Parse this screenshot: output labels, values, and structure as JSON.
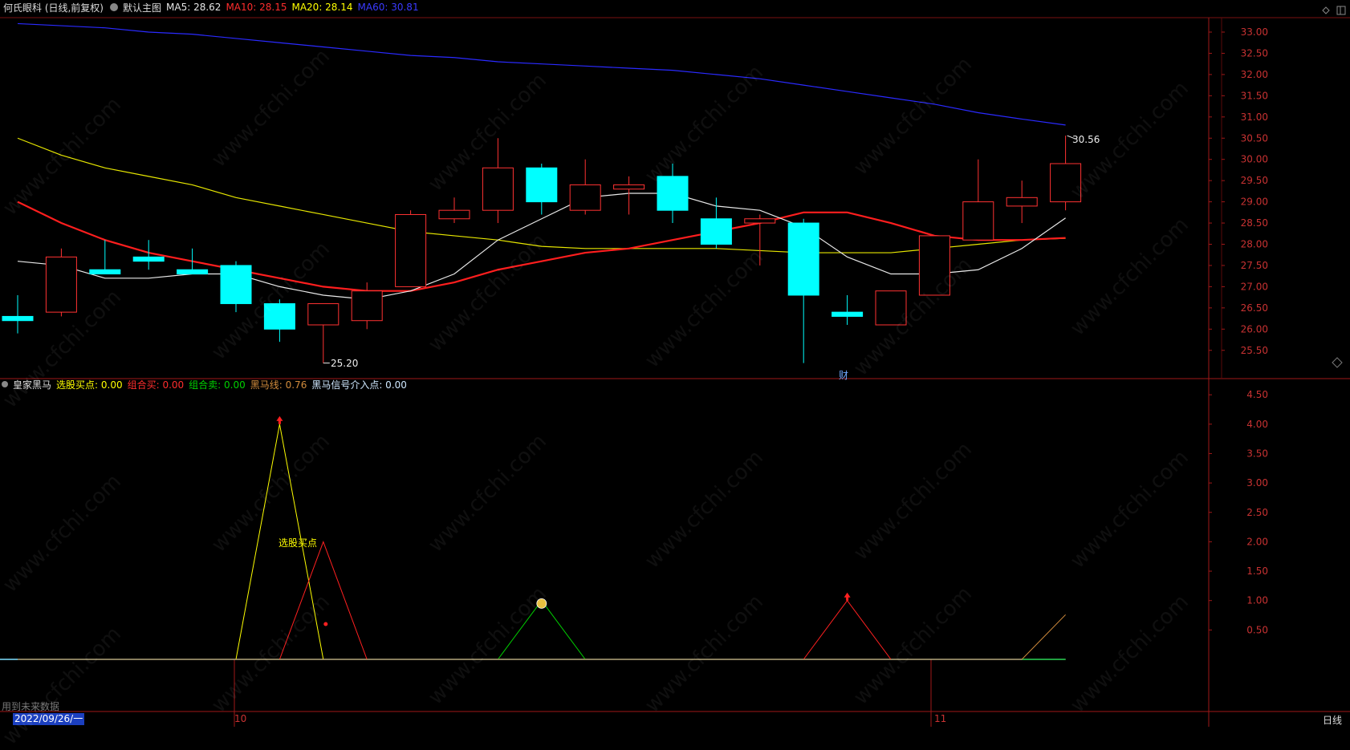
{
  "header": {
    "stock_name": "何氏眼科 (日线,前复权)",
    "template": "默认主图",
    "ma": [
      {
        "label": "MA5: 28.62",
        "color": "#e6e6e6"
      },
      {
        "label": "MA10: 28.15",
        "color": "#ff2d2d"
      },
      {
        "label": "MA20: 28.14",
        "color": "#ffff00"
      },
      {
        "label": "MA60: 30.81",
        "color": "#3a3aff"
      }
    ]
  },
  "indicator_header": {
    "name": "皇家黑马",
    "items": [
      {
        "label": "选股买点: 0.00",
        "color": "#ffff00"
      },
      {
        "label": "组合买: 0.00",
        "color": "#ff2d2d"
      },
      {
        "label": "组合卖: 0.00",
        "color": "#00d000"
      },
      {
        "label": "黑马线: 0.76",
        "color": "#d28c3c"
      },
      {
        "label": "黑马信号介入点: 0.00",
        "color": "#cfe8ff"
      }
    ]
  },
  "annotations": {
    "high_label": "30.56",
    "low_label": "25.20",
    "cai_label": "财",
    "signal_label": "选股买点",
    "future_data": "用到未来数据"
  },
  "footer": {
    "date": "2022/09/26/一",
    "period": "日线",
    "month_labels": [
      "10",
      "11"
    ]
  },
  "watermark": "www.cfchi.com",
  "chart_data": {
    "type": "candlestick",
    "price_ticks": [
      "33.00",
      "32.50",
      "32.00",
      "31.50",
      "31.00",
      "30.50",
      "30.00",
      "29.50",
      "29.00",
      "28.50",
      "28.00",
      "27.50",
      "27.00",
      "26.50",
      "26.00",
      "25.50"
    ],
    "indicator_ticks": [
      "4.50",
      "4.00",
      "3.50",
      "3.00",
      "2.50",
      "2.00",
      "1.50",
      "1.00",
      "0.50"
    ],
    "candles": [
      {
        "o": 26.3,
        "h": 26.8,
        "l": 25.9,
        "c": 26.2
      },
      {
        "o": 26.4,
        "h": 27.9,
        "l": 26.3,
        "c": 27.7
      },
      {
        "o": 27.4,
        "h": 28.1,
        "l": 27.3,
        "c": 27.3
      },
      {
        "o": 27.7,
        "h": 28.1,
        "l": 27.4,
        "c": 27.6
      },
      {
        "o": 27.4,
        "h": 27.9,
        "l": 27.3,
        "c": 27.3
      },
      {
        "o": 27.5,
        "h": 27.6,
        "l": 26.4,
        "c": 26.6
      },
      {
        "o": 26.6,
        "h": 26.7,
        "l": 25.7,
        "c": 26.0
      },
      {
        "o": 26.1,
        "h": 26.6,
        "l": 25.2,
        "c": 26.6
      },
      {
        "o": 26.2,
        "h": 27.1,
        "l": 26.0,
        "c": 26.9
      },
      {
        "o": 27.0,
        "h": 28.8,
        "l": 27.0,
        "c": 28.7
      },
      {
        "o": 28.6,
        "h": 29.1,
        "l": 28.5,
        "c": 28.8
      },
      {
        "o": 28.8,
        "h": 30.5,
        "l": 28.5,
        "c": 29.8
      },
      {
        "o": 29.8,
        "h": 29.9,
        "l": 28.7,
        "c": 29.0
      },
      {
        "o": 28.8,
        "h": 30.0,
        "l": 28.7,
        "c": 29.4
      },
      {
        "o": 29.3,
        "h": 29.6,
        "l": 28.7,
        "c": 29.4
      },
      {
        "o": 29.6,
        "h": 29.9,
        "l": 28.5,
        "c": 28.8
      },
      {
        "o": 28.6,
        "h": 29.1,
        "l": 27.9,
        "c": 28.0
      },
      {
        "o": 28.5,
        "h": 28.7,
        "l": 27.5,
        "c": 28.6
      },
      {
        "o": 28.5,
        "h": 28.6,
        "l": 25.2,
        "c": 26.8
      },
      {
        "o": 26.4,
        "h": 26.8,
        "l": 26.1,
        "c": 26.3
      },
      {
        "o": 26.1,
        "h": 26.9,
        "l": 26.1,
        "c": 26.9
      },
      {
        "o": 26.8,
        "h": 28.2,
        "l": 26.8,
        "c": 28.2
      },
      {
        "o": 28.1,
        "h": 30.0,
        "l": 28.1,
        "c": 29.0
      },
      {
        "o": 28.9,
        "h": 29.5,
        "l": 28.5,
        "c": 29.1
      },
      {
        "o": 29.0,
        "h": 30.56,
        "l": 28.8,
        "c": 29.9
      }
    ],
    "ma5": [
      27.6,
      27.5,
      27.2,
      27.2,
      27.3,
      27.3,
      27.0,
      26.8,
      26.7,
      26.9,
      27.3,
      28.1,
      28.6,
      29.1,
      29.2,
      29.2,
      28.9,
      28.8,
      28.4,
      27.7,
      27.3,
      27.3,
      27.4,
      27.9,
      28.62
    ],
    "ma10": [
      29.0,
      28.5,
      28.1,
      27.8,
      27.6,
      27.4,
      27.2,
      27.0,
      26.9,
      26.9,
      27.1,
      27.4,
      27.6,
      27.8,
      27.9,
      28.1,
      28.3,
      28.5,
      28.75,
      28.75,
      28.5,
      28.2,
      28.1,
      28.1,
      28.15
    ],
    "ma20": [
      30.5,
      30.1,
      29.8,
      29.6,
      29.4,
      29.1,
      28.9,
      28.7,
      28.5,
      28.3,
      28.2,
      28.1,
      27.95,
      27.9,
      27.9,
      27.9,
      27.9,
      27.85,
      27.8,
      27.8,
      27.8,
      27.9,
      28.0,
      28.1,
      28.14
    ],
    "ma60": [
      33.2,
      33.15,
      33.1,
      33.0,
      32.95,
      32.85,
      32.75,
      32.65,
      32.55,
      32.45,
      32.4,
      32.3,
      32.25,
      32.2,
      32.15,
      32.1,
      32.0,
      31.9,
      31.75,
      31.6,
      31.45,
      31.3,
      31.1,
      30.95,
      30.81
    ],
    "yellow_line": [
      0,
      0,
      0,
      0,
      0,
      0,
      4,
      0,
      0,
      0,
      0,
      0,
      0,
      0,
      0,
      0,
      0,
      0,
      0,
      0,
      0,
      0,
      0,
      0,
      0
    ],
    "red_line": [
      0,
      0,
      0,
      0,
      0,
      0,
      0,
      2,
      0,
      0,
      0,
      0,
      0,
      0,
      0,
      0,
      0,
      0,
      0,
      1,
      0,
      0,
      0,
      0,
      0
    ],
    "green_line": [
      0,
      0,
      0,
      0,
      0,
      0,
      0,
      0,
      0,
      0,
      0,
      0,
      1,
      0,
      0,
      0,
      0,
      0,
      0,
      0,
      0,
      0,
      0,
      0,
      0
    ],
    "orange_line": [
      0,
      0,
      0,
      0,
      0,
      0,
      0,
      0,
      0,
      0,
      0,
      0,
      0,
      0,
      0,
      0,
      0,
      0,
      0,
      0,
      0,
      0,
      0,
      0,
      0.76
    ]
  }
}
